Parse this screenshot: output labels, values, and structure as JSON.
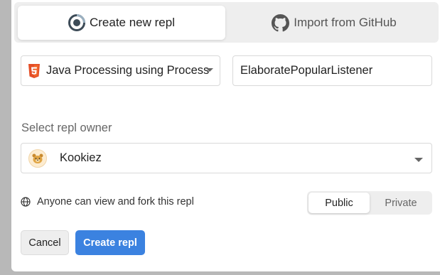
{
  "tabs": {
    "create_label": "Create new repl",
    "import_label": "Import from GitHub"
  },
  "template": {
    "selected": "Java Processing using Processing",
    "icon": "html5-icon"
  },
  "repl_name": {
    "value": "ElaboratePopularListener"
  },
  "owner": {
    "label": "Select repl owner",
    "selected": "Kookiez",
    "avatar_icon": "bear-avatar-icon"
  },
  "visibility": {
    "description": "Anyone can view and fork this repl",
    "public_label": "Public",
    "private_label": "Private",
    "selected": "Public"
  },
  "actions": {
    "cancel_label": "Cancel",
    "create_label": "Create repl"
  },
  "colors": {
    "primary": "#3b82e0",
    "html5": "#e44d26"
  }
}
